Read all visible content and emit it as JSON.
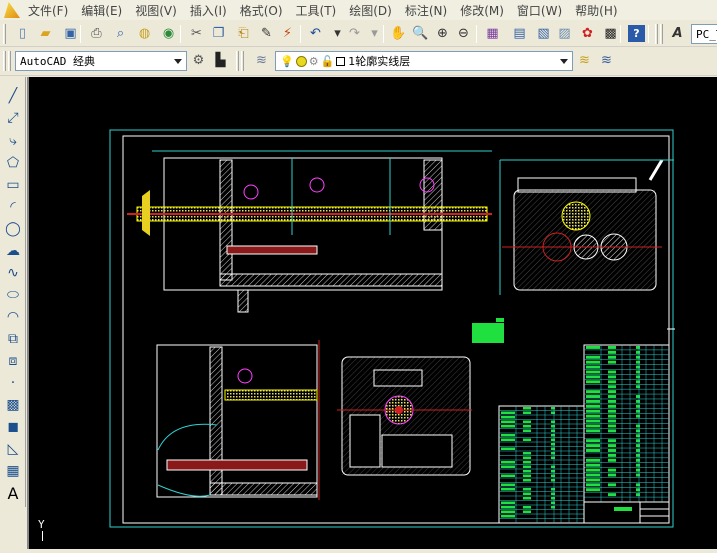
{
  "menu": [
    "文件(F)",
    "编辑(E)",
    "视图(V)",
    "插入(I)",
    "格式(O)",
    "工具(T)",
    "绘图(D)",
    "标注(N)",
    "修改(M)",
    "窗口(W)",
    "帮助(H)"
  ],
  "standard_toolbar": [
    {
      "icon": "new-icon",
      "glyph": "▯",
      "color": "#5a7fb0"
    },
    {
      "icon": "open-icon",
      "glyph": "▰",
      "color": "#d9a520"
    },
    {
      "icon": "save-icon",
      "glyph": "▣",
      "color": "#3463a8"
    },
    {
      "icon": "plot-icon",
      "glyph": "⎙",
      "color": "#555"
    },
    {
      "icon": "plot-preview-icon",
      "glyph": "⌕",
      "color": "#3463a8"
    },
    {
      "icon": "publish-icon",
      "glyph": "◍",
      "color": "#c8a020"
    },
    {
      "icon": "3d-dwf-icon",
      "glyph": "◉",
      "color": "#2c8a3c"
    },
    {
      "icon": "cut-icon",
      "glyph": "✂",
      "color": "#555"
    },
    {
      "icon": "copy-icon",
      "glyph": "❐",
      "color": "#3463a8"
    },
    {
      "icon": "paste-icon",
      "glyph": "⎗",
      "color": "#b8860b"
    },
    {
      "icon": "match-properties-icon",
      "glyph": "✎",
      "color": "#333"
    },
    {
      "icon": "block-editor-icon",
      "glyph": "⚡",
      "color": "#c84a10"
    },
    {
      "icon": "undo-icon",
      "glyph": "↶",
      "color": "#1a4a9a"
    },
    {
      "icon": "undo-dropdown-icon",
      "glyph": "▾",
      "color": "#333"
    },
    {
      "icon": "redo-icon",
      "glyph": "↷",
      "color": "#999"
    },
    {
      "icon": "redo-dropdown-icon",
      "glyph": "▾",
      "color": "#999"
    },
    {
      "icon": "pan-icon",
      "glyph": "✋",
      "color": "#c87a40"
    },
    {
      "icon": "zoom-realtime-icon",
      "glyph": "🔍",
      "color": "#333"
    },
    {
      "icon": "zoom-window-icon",
      "glyph": "⊕",
      "color": "#333"
    },
    {
      "icon": "zoom-previous-icon",
      "glyph": "⊖",
      "color": "#333"
    },
    {
      "icon": "properties-icon",
      "glyph": "▦",
      "color": "#7a3aa0"
    },
    {
      "icon": "design-center-icon",
      "glyph": "▤",
      "color": "#3463a8"
    },
    {
      "icon": "tool-palettes-icon",
      "glyph": "▧",
      "color": "#3463a8"
    },
    {
      "icon": "sheet-set-icon",
      "glyph": "▨",
      "color": "#6a8ab0"
    },
    {
      "icon": "markup-icon",
      "glyph": "✿",
      "color": "#d02020"
    },
    {
      "icon": "calculator-icon",
      "glyph": "▩",
      "color": "#222"
    },
    {
      "icon": "help-icon",
      "glyph": "?",
      "color": "#fff"
    }
  ],
  "text_style": {
    "icon": "text-style-icon",
    "value": "PC_T"
  },
  "workspace": {
    "value": "AutoCAD 经典",
    "settings_icon": "workspace-settings-icon",
    "lock_icon": "toolbar-lock-icon"
  },
  "layers": {
    "manager_icon": "layer-manager-icon",
    "state_icons": [
      "bulb-on-icon",
      "sun-icon",
      "viewport-freeze-icon",
      "lock-open-icon",
      "color-swatch-icon"
    ],
    "value": "1轮廓实线层",
    "make_current_icon": "make-object-layer-current-icon",
    "previous_icon": "layer-previous-icon"
  },
  "draw_toolbar": [
    {
      "icon": "line-icon",
      "glyph": "╱"
    },
    {
      "icon": "construction-line-icon",
      "glyph": "⤢"
    },
    {
      "icon": "polyline-icon",
      "glyph": "⤷"
    },
    {
      "icon": "polygon-icon",
      "glyph": "⬠"
    },
    {
      "icon": "rectangle-icon",
      "glyph": "▭"
    },
    {
      "icon": "arc-icon",
      "glyph": "◜"
    },
    {
      "icon": "circle-icon",
      "glyph": "◯"
    },
    {
      "icon": "revision-cloud-icon",
      "glyph": "☁"
    },
    {
      "icon": "spline-icon",
      "glyph": "∿"
    },
    {
      "icon": "ellipse-icon",
      "glyph": "⬭"
    },
    {
      "icon": "ellipse-arc-icon",
      "glyph": "◠"
    },
    {
      "icon": "insert-block-icon",
      "glyph": "⧉"
    },
    {
      "icon": "make-block-icon",
      "glyph": "⧈"
    },
    {
      "icon": "point-icon",
      "glyph": "·"
    },
    {
      "icon": "hatch-icon",
      "glyph": "▩"
    },
    {
      "icon": "gradient-icon",
      "glyph": "◼"
    },
    {
      "icon": "region-icon",
      "glyph": "◺"
    },
    {
      "icon": "table-icon",
      "glyph": "▦"
    },
    {
      "icon": "multiline-text-icon",
      "glyph": "A"
    }
  ],
  "ucs": {
    "y_label": "Y"
  },
  "colors": {
    "background": "#000000",
    "frame_outer": "#2fd0d0",
    "frame_inner": "#ffffff",
    "text": "#20ff40",
    "hatch": "#ffffff",
    "center_line": "#d02020",
    "part": "#ffff60",
    "highlight": "#ff40ff"
  }
}
